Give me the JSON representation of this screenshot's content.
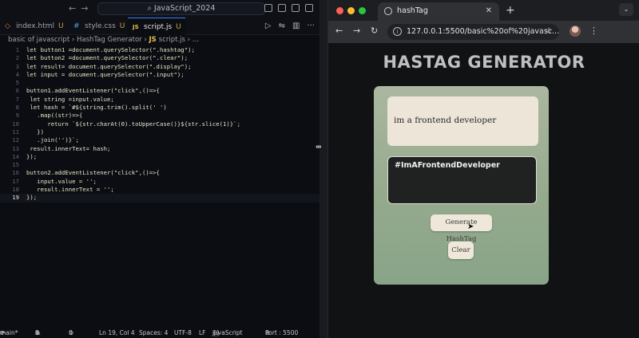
{
  "vscode": {
    "window_title": "JavaScript_2024",
    "tabs": [
      {
        "icon": "html-icon",
        "label": "index.html",
        "modified": "U"
      },
      {
        "icon": "css-icon",
        "label": "style.css",
        "modified": "U"
      },
      {
        "icon": "js-icon",
        "label": "script.js",
        "modified": "U"
      }
    ],
    "active_tab": "script.js",
    "breadcrumb": {
      "folder": "basic of javascript",
      "subfolder": "HashTag Generator",
      "file": "script.js",
      "trail": "…"
    },
    "code_lines": [
      {
        "n": "1",
        "text": "let button1 =document.querySelector(\".hashtag\");"
      },
      {
        "n": "2",
        "text": "let button2 =document.querySelector(\".clear\");"
      },
      {
        "n": "3",
        "text": "let result= document.querySelector(\".display\");"
      },
      {
        "n": "4",
        "text": "let input = document.querySelector(\".input\");"
      },
      {
        "n": "5",
        "text": ""
      },
      {
        "n": "6",
        "text": "button1.addEventListener(\"click\",()=>{"
      },
      {
        "n": "7",
        "text": " let string =input.value;"
      },
      {
        "n": "8",
        "text": " let hash = `#${string.trim().split(' ')"
      },
      {
        "n": "9",
        "text": "   .map((str)=>{"
      },
      {
        "n": "10",
        "text": "      return `${str.charAt(0).toUpperCase()}${str.slice(1)}`;"
      },
      {
        "n": "11",
        "text": "   })"
      },
      {
        "n": "12",
        "text": "   .join('')}`;"
      },
      {
        "n": "13",
        "text": " result.innerText= hash;"
      },
      {
        "n": "14",
        "text": "});"
      },
      {
        "n": "15",
        "text": ""
      },
      {
        "n": "16",
        "text": "button2.addEventListener(\"click\",()=>{"
      },
      {
        "n": "17",
        "text": "   input.value = '';"
      },
      {
        "n": "18",
        "text": "   result.innerText = '';"
      },
      {
        "n": "19",
        "text": "});"
      }
    ],
    "current_line": "19",
    "status": {
      "branch": "main*",
      "errors": "0",
      "warnings": "0",
      "ports": "0",
      "position": "Ln 19, Col 4",
      "spaces": "Spaces: 4",
      "encoding": "UTF-8",
      "eol": "LF",
      "language": "JavaScript",
      "port": "Port : 5500"
    }
  },
  "browser": {
    "tab_title": "hashTag",
    "url": "127.0.0.1:5500/basic%20of%20javasc...",
    "page": {
      "heading": "HASTAG GENERATOR",
      "input_value": "im a frontend developer",
      "result_text": "#ImAFrontendDeveloper",
      "generate_label": "Generate HashTag",
      "clear_label": "Clear"
    }
  },
  "colors": {
    "editor_bg": "#0b0d12",
    "card_top": "#abb7a0",
    "card_bottom": "#89a489",
    "display_bg": "#1f2221",
    "button_bg": "#eee7da",
    "traffic_red": "#ff5f57",
    "traffic_yellow": "#febc2e",
    "traffic_green": "#28c840"
  }
}
